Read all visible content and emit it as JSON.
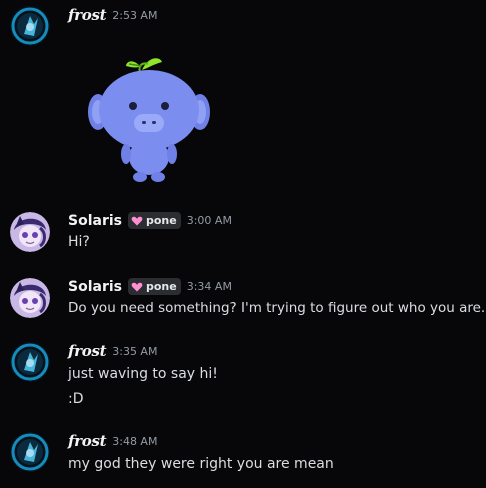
{
  "messages": [
    {
      "author": "frost",
      "timestamp": "2:53 AM",
      "sticker": "wumpus-sticker",
      "avatar": "frost-avatar"
    },
    {
      "author": "Solaris",
      "tag": "pone",
      "tag_icon": "pink-heart-icon",
      "timestamp": "3:00 AM",
      "lines": [
        "Hi?"
      ],
      "avatar": "solaris-avatar"
    },
    {
      "author": "Solaris",
      "tag": "pone",
      "tag_icon": "pink-heart-icon",
      "timestamp": "3:34 AM",
      "lines": [
        "Do you need something? I'm trying to figure out who you are."
      ],
      "avatar": "solaris-avatar"
    },
    {
      "author": "frost",
      "timestamp": "3:35 AM",
      "lines": [
        "just waving to say hi!",
        ":D"
      ],
      "avatar": "frost-avatar"
    },
    {
      "author": "frost",
      "timestamp": "3:48 AM",
      "lines": [
        "my god they were right you are mean"
      ],
      "avatar": "frost-avatar"
    }
  ],
  "colors": {
    "background": "#070709",
    "username": "#f2f3f5",
    "message_text": "#dbdee1",
    "timestamp": "#949ba4",
    "tag_bg": "#2b2d31",
    "wumpus": "#7b8ef0",
    "leaf": "#8ee52a",
    "heart": "#ff8fcf"
  }
}
